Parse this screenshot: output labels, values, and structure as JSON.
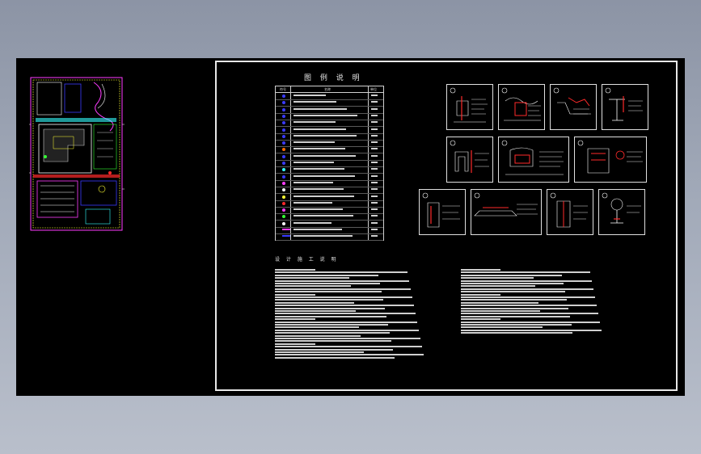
{
  "drawing": {
    "legend_title": "图 例 说 明",
    "notes_title": "设 计 施 工 说 明",
    "legend_header": {
      "col1": "符号",
      "col2": "名称",
      "col3": "单位"
    }
  },
  "colors": {
    "canvas_background": "#000000",
    "frame": "#e8e8e8",
    "cad_red": "#ff2a2a",
    "cad_magenta": "#ff3cff",
    "cad_blue": "#3a3aff",
    "cad_yellow": "#ffff33",
    "cad_cyan": "#33ffff",
    "cad_green": "#33ff33"
  }
}
